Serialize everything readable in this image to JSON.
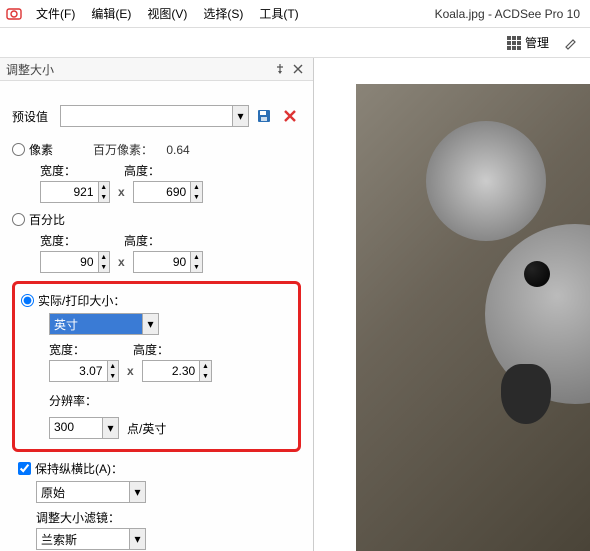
{
  "app_title": "Koala.jpg - ACDSee Pro 10",
  "menu": {
    "file": "文件(F)",
    "edit": "编辑(E)",
    "view": "视图(V)",
    "select": "选择(S)",
    "tools": "工具(T)"
  },
  "toolbar": {
    "manage": "管理"
  },
  "panel": {
    "title": "调整大小",
    "preset_label": "预设值",
    "megapixel_label": "百万像素：",
    "megapixel_value": "0.64",
    "pixels_radio": "像素",
    "percent_radio": "百分比",
    "actual_radio": "实际/打印大小：",
    "width_label": "宽度：",
    "height_label": "高度：",
    "pixel_width": "921",
    "pixel_height": "690",
    "percent_width": "90",
    "percent_height": "90",
    "unit_selected": "英寸",
    "actual_width": "3.07",
    "actual_height": "2.30",
    "resolution_label": "分辨率：",
    "resolution_value": "300",
    "resolution_unit": "点/英寸",
    "keep_aspect": "保持纵横比(A)：",
    "aspect_selected": "原始",
    "filter_label": "调整大小滤镜：",
    "filter_selected": "兰索斯"
  }
}
